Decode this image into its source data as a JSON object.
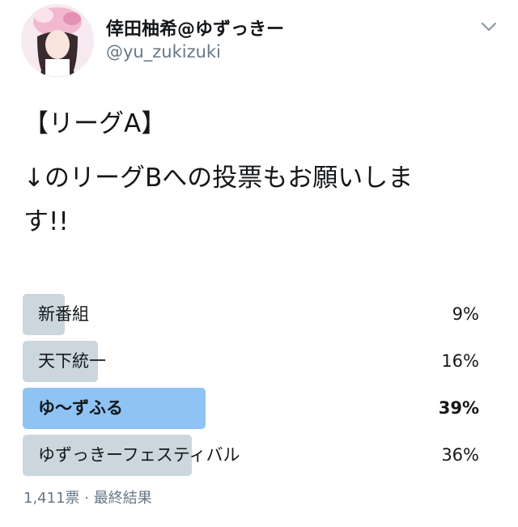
{
  "user": {
    "display_name": "倖田柚希@ゆずっきー",
    "handle": "@yu_zukizuki"
  },
  "tweet": {
    "title_line": "【リーグA】",
    "body_line_1": "↓のリーグBへの投票もお願いしま",
    "body_line_2": "す!!"
  },
  "poll": {
    "options": [
      {
        "label": "新番組",
        "percent_text": "9%",
        "value": 9,
        "leading": false
      },
      {
        "label": "天下統一",
        "percent_text": "16%",
        "value": 16,
        "leading": false
      },
      {
        "label": "ゆ〜ずふる",
        "percent_text": "39%",
        "value": 39,
        "leading": true
      },
      {
        "label": "ゆずっきーフェスティバル",
        "percent_text": "36%",
        "value": 36,
        "leading": false
      }
    ],
    "footer": "1,411票 · 最終結果"
  },
  "colors": {
    "bar": "#ccd6dd",
    "bar_leading": "#8ec3f4",
    "secondary_text": "#657786"
  },
  "icons": {
    "menu": "chevron-down-icon"
  }
}
